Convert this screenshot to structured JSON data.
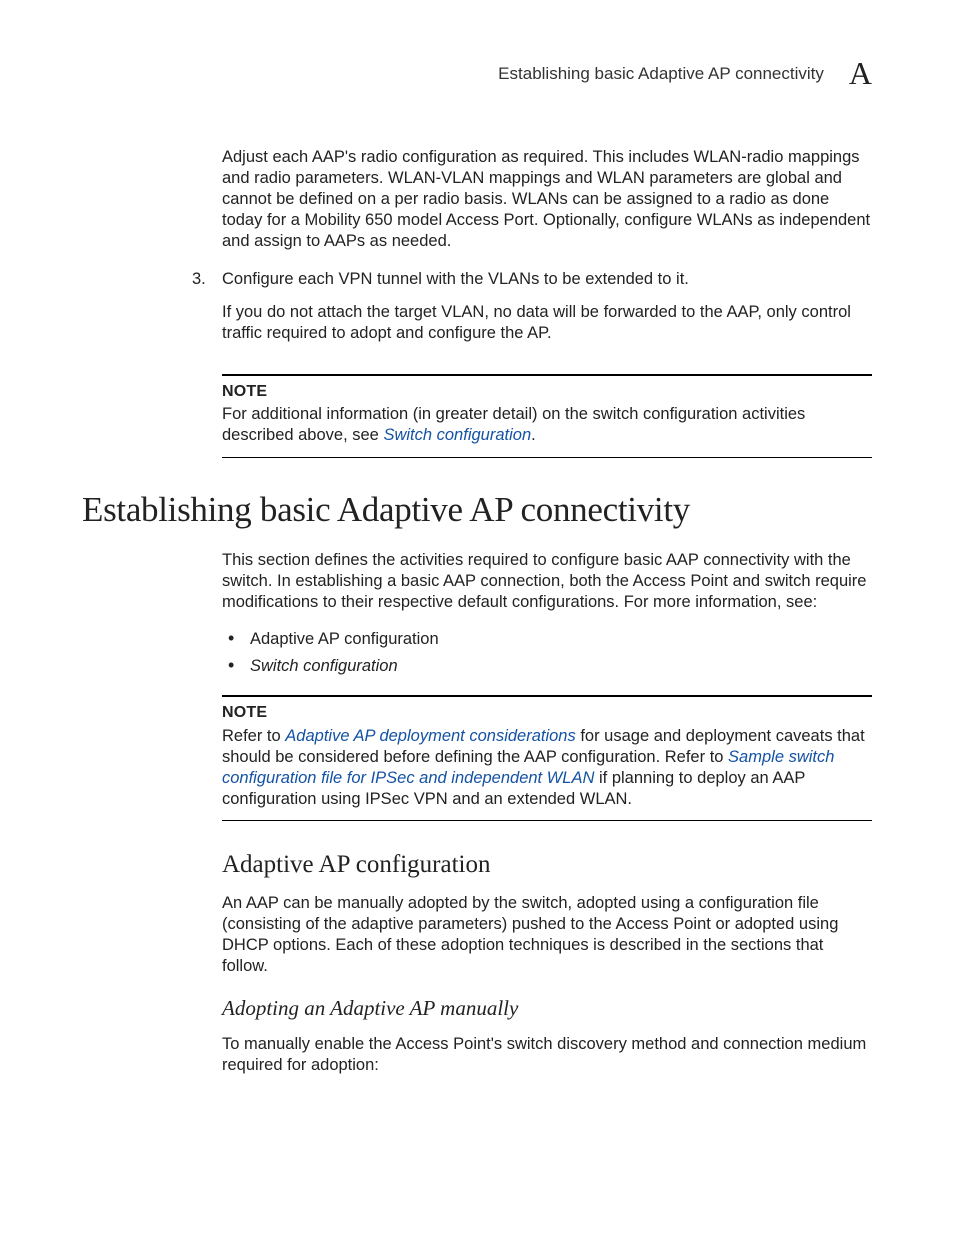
{
  "header": {
    "running_title": "Establishing basic Adaptive AP connectivity",
    "letter": "A"
  },
  "intro_continuation": {
    "para1": "Adjust each AAP's radio configuration as required. This includes WLAN-radio mappings and radio parameters. WLAN-VLAN mappings and WLAN parameters are global and cannot be defined on a per radio basis. WLANs can be assigned to a radio as done today for a Mobility 650 model Access Port. Optionally, configure WLANs as independent and assign to AAPs as needed."
  },
  "step3": {
    "num": "3.",
    "line1": "Configure each VPN tunnel with the VLANs to be extended to it.",
    "line2": "If you do not attach the target VLAN, no data will be forwarded to the AAP, only control traffic required to adopt and configure the AP."
  },
  "note1": {
    "label": "NOTE",
    "pre": "For additional information (in greater detail) on the switch configuration activities described above, see ",
    "link": "Switch configuration",
    "post": "."
  },
  "h1": "Establishing basic Adaptive AP connectivity",
  "section_intro": "This section defines the activities required to configure basic AAP connectivity with the switch. In establishing a basic AAP connection, both the Access Point and switch require modifications to their respective default configurations. For more information, see:",
  "bullets": {
    "b1": "Adaptive AP configuration",
    "b2": "Switch configuration"
  },
  "note2": {
    "label": "NOTE",
    "pre": "Refer to ",
    "link1": "Adaptive AP deployment considerations",
    "mid1": " for usage and deployment caveats that should be considered before defining the AAP configuration. Refer to ",
    "link2": "Sample switch configuration file for IPSec and independent WLAN",
    "post": " if planning to deploy an AAP configuration using IPSec VPN and an extended WLAN."
  },
  "h2": "Adaptive AP configuration",
  "aap_para": "An AAP can be manually adopted by the switch, adopted using a configuration file (consisting of the adaptive parameters) pushed to the Access Point or adopted using DHCP options. Each of these adoption techniques is described in the sections that follow.",
  "h3": "Adopting an Adaptive AP manually",
  "h3_para": "To manually enable the Access Point's switch discovery method and connection medium required for adoption:"
}
